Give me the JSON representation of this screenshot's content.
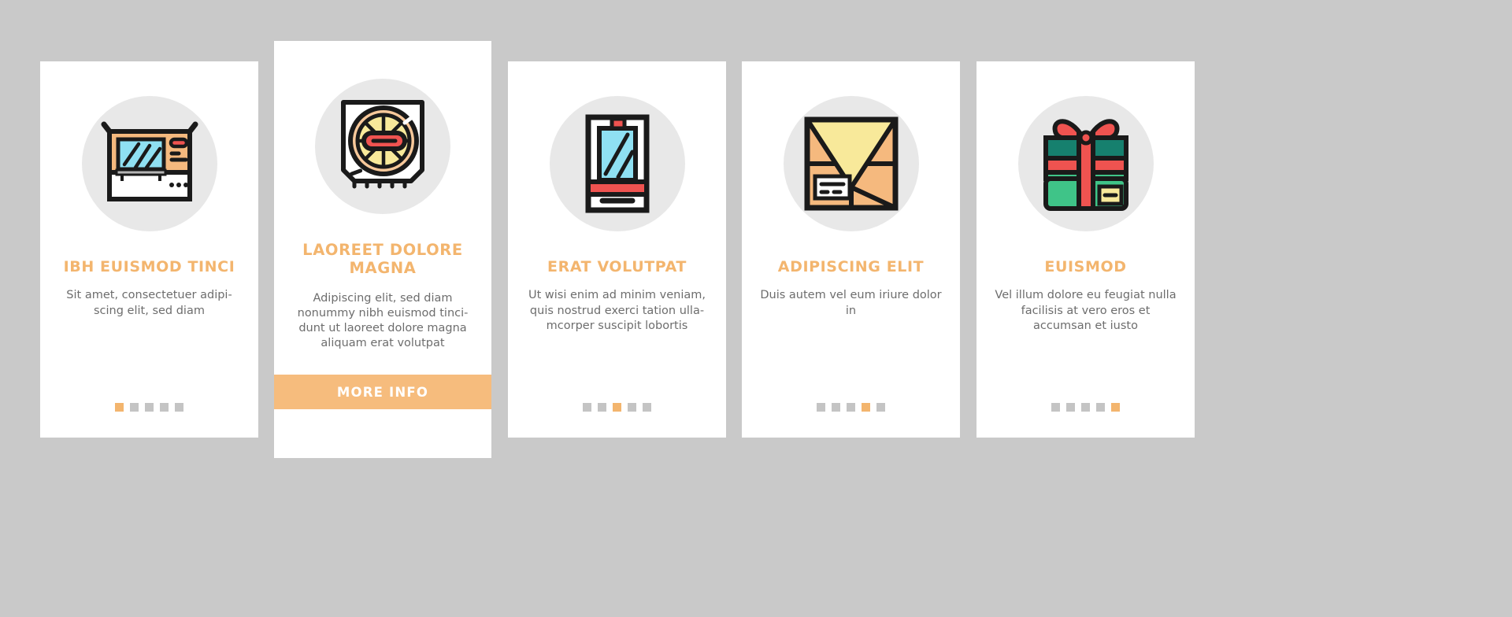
{
  "background_color": "#c9c9c9",
  "theme": {
    "card_bg": "#ffffff",
    "title_color": "#f3b56e",
    "body_text_color": "#6d6d6d",
    "icon_circle_color": "#e8e8e8",
    "accent_color": "#f3b56e",
    "dot_inactive_color": "#c4c4c4",
    "button_bg": "#f6bc7d",
    "button_text_color": "#ffffff"
  },
  "cards": [
    {
      "icon_name": "microwave-oven-icon",
      "title": "IBH EUISMOD TINCI",
      "description": "Sit amet, consectetuer adipi-scing elit, sed diam",
      "dots_total": 5,
      "dot_active_index": 1,
      "featured": false
    },
    {
      "icon_name": "ventilation-fan-icon",
      "title": "LAOREET DOLORE MAGNA",
      "description": "Adipiscing elit, sed diam nonummy nibh euismod tinci-dunt ut laoreet dolore magna aliquam erat volutpat",
      "dots_total": 5,
      "dot_active_index": 2,
      "featured": true,
      "button_label": "MORE INFO"
    },
    {
      "icon_name": "smartphone-icon",
      "title": "ERAT VOLUTPAT",
      "description": "Ut wisi enim ad minim veniam, quis nostrud exerci tation ulla-mcorper suscipit lobortis",
      "dots_total": 5,
      "dot_active_index": 3,
      "featured": false
    },
    {
      "icon_name": "package-box-icon",
      "title": "ADIPISCING ELIT",
      "description": "Duis autem vel eum iriure dolor in",
      "dots_total": 5,
      "dot_active_index": 4,
      "featured": false
    },
    {
      "icon_name": "gift-box-icon",
      "title": "EUISMOD",
      "description": "Vel illum dolore eu feugiat nulla facilisis at vero eros et accumsan et iusto",
      "dots_total": 5,
      "dot_active_index": 5,
      "featured": false
    }
  ]
}
